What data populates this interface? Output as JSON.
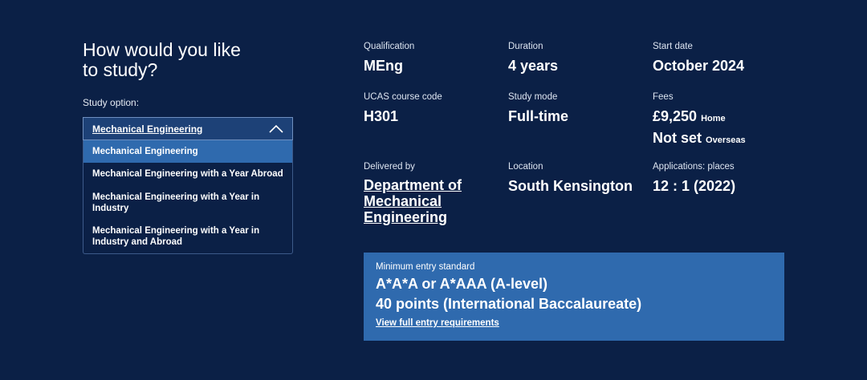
{
  "heading": "How would you like to study?",
  "study_option": {
    "label": "Study option:",
    "selected": "Mechanical Engineering",
    "options": [
      "Mechanical Engineering",
      "Mechanical Engineering with a Year Abroad",
      "Mechanical Engineering with a Year in Industry",
      "Mechanical Engineering with a Year in Industry and Abroad"
    ]
  },
  "details": {
    "qualification": {
      "label": "Qualification",
      "value": "MEng"
    },
    "duration": {
      "label": "Duration",
      "value": "4 years"
    },
    "start_date": {
      "label": "Start date",
      "value": "October 2024"
    },
    "ucas": {
      "label": "UCAS course code",
      "value": "H301"
    },
    "study_mode": {
      "label": "Study mode",
      "value": "Full-time"
    },
    "fees": {
      "label": "Fees",
      "home_value": "£9,250",
      "home_note": "Home",
      "overseas_value": "Not set",
      "overseas_note": "Overseas"
    },
    "delivered_by": {
      "label": "Delivered by",
      "value": "Department of Mechanical Engineering"
    },
    "location": {
      "label": "Location",
      "value": "South Kensington"
    },
    "applications": {
      "label": "Applications: places",
      "value": "12 : 1 (2022)"
    }
  },
  "entry": {
    "label": "Minimum entry standard",
    "line1": "A*A*A or A*AAA (A-level)",
    "line2": "40 points (International Baccalaureate)",
    "link": "View full entry requirements"
  }
}
